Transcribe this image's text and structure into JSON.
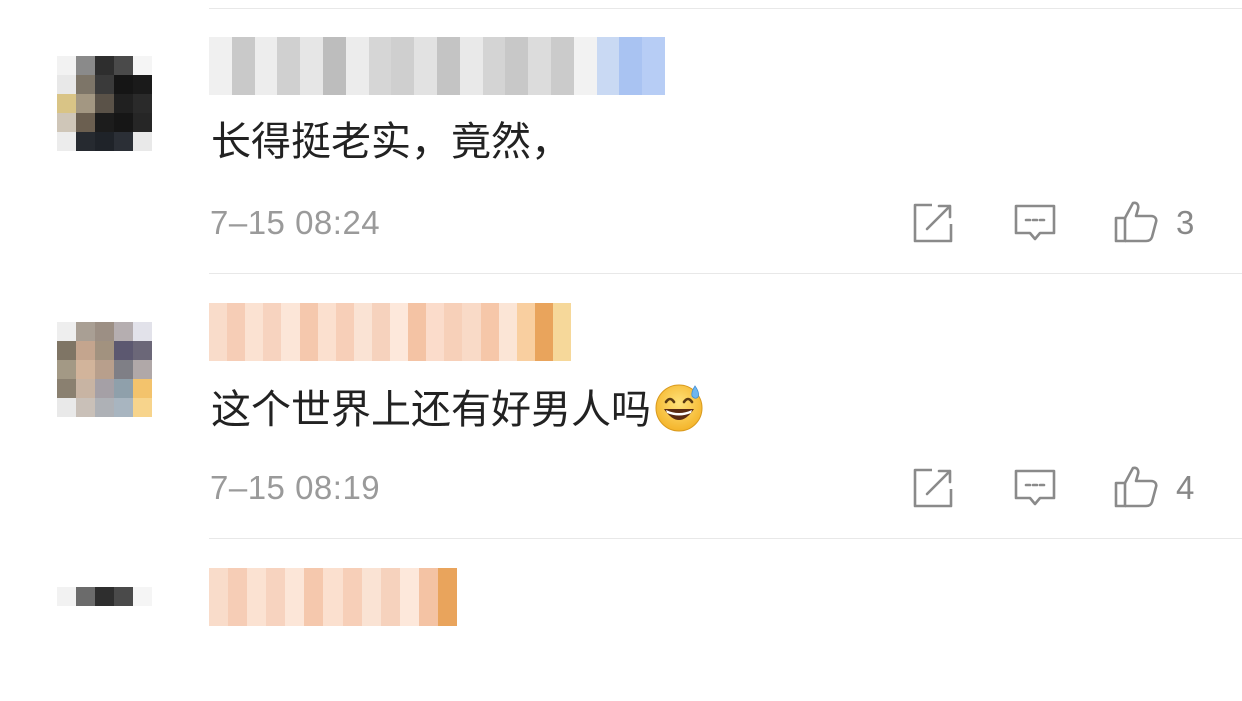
{
  "comments": [
    {
      "content": "长得挺老实，竟然，",
      "time": "7–15 08:24",
      "likes": "3",
      "avatar_colors": [
        "#f2f2f2",
        "#8a8a8a",
        "#2e2e2e",
        "#4a4a4a",
        "#f5f5f5",
        "#e8e8e8",
        "#7d7568",
        "#3a3a3a",
        "#151515",
        "#1a1a1a",
        "#d9c486",
        "#a39782",
        "#5a5248",
        "#202020",
        "#2a2a2a",
        "#cfc6b8",
        "#6b5f50",
        "#1c1c1c",
        "#161616",
        "#262626",
        "#ececec",
        "#262a30",
        "#1f2329",
        "#2b2f36",
        "#e9e9e9"
      ],
      "name_colors": [
        "#f0f0f0",
        "#c9c9c9",
        "#ededed",
        "#d0d0d0",
        "#e6e6e6",
        "#bdbdbd",
        "#ececec",
        "#d6d6d6",
        "#cfcfcf",
        "#e2e2e2",
        "#c4c4c4",
        "#e9e9e9",
        "#d4d4d4",
        "#c8c8c8",
        "#dcdcdc",
        "#cbcbcb",
        "#f2f2f2",
        "#c9d9f3",
        "#a9c3f2",
        "#b7cdf5"
      ]
    },
    {
      "content": "这个世界上还有好男人吗",
      "emoji": "grinning-sweat-emoji",
      "time": "7–15 08:19",
      "likes": "4",
      "avatar_colors": [
        "#eeeeee",
        "#a99f94",
        "#9c8f84",
        "#b5aeb0",
        "#e2e2ea",
        "#7f7565",
        "#c4a58e",
        "#a2927f",
        "#5c5870",
        "#6b6778",
        "#a39985",
        "#d2b49b",
        "#b89f8c",
        "#7f7f86",
        "#b0a8a8",
        "#8a8070",
        "#c8b4a3",
        "#a5a0a6",
        "#8fa0ab",
        "#f3c36c",
        "#e9e9e9",
        "#c9c0b8",
        "#aeb1b6",
        "#a8b5c0",
        "#f7d48c"
      ],
      "name_colors": [
        "#f9dcca",
        "#f6cdb6",
        "#fbe2d2",
        "#f7d3bf",
        "#fce6d8",
        "#f5c8ad",
        "#fbe0cf",
        "#f7cfb8",
        "#fae3d4",
        "#f6d2bd",
        "#fde8db",
        "#f4c3a4",
        "#fbdccb",
        "#f7d0b9",
        "#f9dac7",
        "#f6c7a9",
        "#fbe5d6",
        "#f9cfa0",
        "#e9a45c",
        "#f6d89a"
      ]
    },
    {
      "avatar_colors": [
        "#f2f2f2",
        "#6b6b6b",
        "#2e2e2e",
        "#4a4a4a",
        "#f5f5f5"
      ],
      "name_colors": [
        "#f9dcca",
        "#f6cdb6",
        "#fbe2d2",
        "#f7d3bf",
        "#fce6d8",
        "#f5c8ad",
        "#fbe0cf",
        "#f7cfb8",
        "#fae3d4",
        "#f6d2bd",
        "#fde8db",
        "#f4c3a4",
        "#e9a45c"
      ]
    }
  ],
  "icons": {
    "share": "share-icon",
    "comment": "comment-icon",
    "like": "thumbs-up-icon"
  },
  "colors": {
    "text": "#222222",
    "meta": "#9a9a9a",
    "divider": "#e8e8e8",
    "icon": "#8a8a8a"
  }
}
